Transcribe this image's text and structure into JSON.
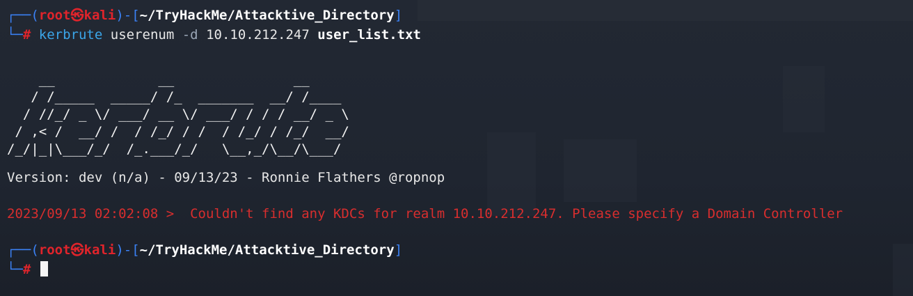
{
  "prompt": {
    "user": "root",
    "at_symbol": "㉿",
    "host": "kali",
    "path": "~/TryHackMe/Attacktive_Directory",
    "symbol": "#"
  },
  "command": {
    "program": "kerbrute",
    "subcommand": "userenum",
    "flag": "-d",
    "domain": "10.10.212.247",
    "file": "user_list.txt"
  },
  "ascii_banner": [
    "    __             __               __     ",
    "   / /_____  _____/ /_  _______  __/ /____ ",
    "  / //_/ _ \\/ ___/ __ \\/ ___/ / / / __/ _ \\",
    " / ,< /  __/ /  / /_/ / /  / /_/ / /_/  __/",
    "/_/|_|\\___/_/  /_.___/_/   \\__,_/\\__/\\___/ "
  ],
  "version_line": "Version: dev (n/a) - 09/13/23 - Ronnie Flathers @ropnop",
  "error_line": "2023/09/13 02:02:08 >  Couldn't find any KDCs for realm 10.10.212.247. Please specify a Domain Controller",
  "second_prompt": {
    "user": "root",
    "at_symbol": "㉿",
    "host": "kali",
    "path": "~/TryHackMe/Attacktive_Directory",
    "symbol": "#"
  },
  "colors": {
    "background": "#1e2430",
    "prompt_frame": "#3b82f6",
    "prompt_user": "#e0242b",
    "command": "#3ba6e9",
    "error": "#d82e2e"
  }
}
